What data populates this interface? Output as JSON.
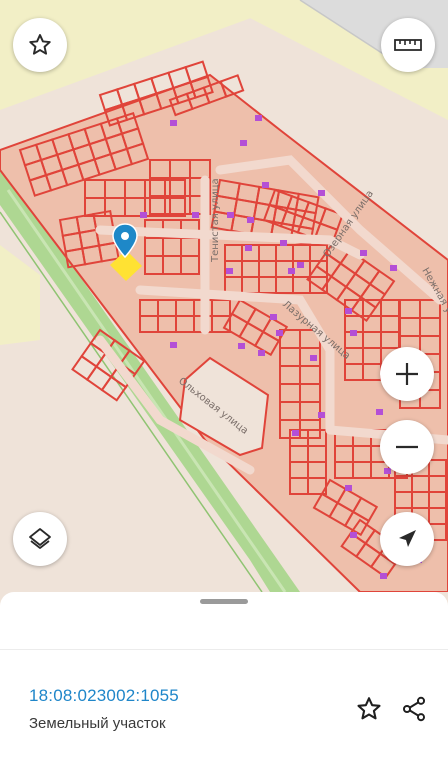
{
  "map": {
    "streets": [
      "Тенистая улица",
      "Озерная улица",
      "Лазурная улица",
      "Ольховая улица",
      "Нежная улица"
    ],
    "icons": {
      "marker": "location-pin-icon",
      "favorite": "star-icon",
      "ruler": "ruler-icon",
      "zoom_in": "plus-icon",
      "zoom_out": "minus-icon",
      "layers": "layers-icon",
      "locate": "navigation-arrow-icon"
    },
    "colors": {
      "background": "#efe3d9",
      "parcel_fill": "#eebfab",
      "parcel_border": "#e0443a",
      "building": "#b44fd6",
      "highway_green": "#a6d58a",
      "fields": "#f2efc6",
      "selected_parcel": "#ffe233",
      "marker": "#1e88c8"
    }
  },
  "sheet": {
    "cadastral_number": "18:08:023002:1055",
    "parcel_type": "Земельный участок",
    "icons": {
      "favorite": "star-outline-icon",
      "share": "share-icon"
    }
  }
}
